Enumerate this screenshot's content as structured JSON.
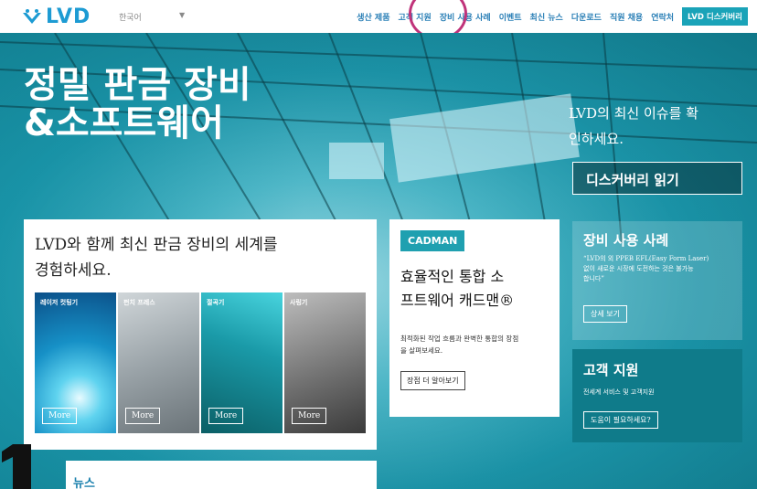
{
  "brand": {
    "name": "LVD",
    "color": "#1d9bd3"
  },
  "header": {
    "language": "한국어",
    "nav": [
      "생산 제품",
      "고객 지원",
      "장비 사용 사례",
      "이벤트",
      "최신 뉴스",
      "다운로드",
      "직원 채용",
      "연락처"
    ],
    "cta": "LVD 디스커버리",
    "accent": "#1aa3b8"
  },
  "hero": {
    "title_line1": "정밀 판금 장비",
    "title_line2": "&소프트웨어",
    "sub_line1": "LVD의 최신 이슈를 확",
    "sub_line2": "인하세요.",
    "discover_label": "디스커버리 읽기"
  },
  "main": {
    "heading_line1": "LVD와 함께 최신 판금 장비의 세계를",
    "heading_line2": "경험하세요.",
    "tiles": [
      {
        "label": "레이저 컷팅기",
        "button": "More"
      },
      {
        "label": "펀치 프레스",
        "button": "More"
      },
      {
        "label": "절곡기",
        "button": "More"
      },
      {
        "label": "사링기",
        "button": "More"
      }
    ]
  },
  "cadman": {
    "logo": "CADMAN",
    "heading_line1": "효율적인 통합 소",
    "heading_line2": "프트웨어 캐드맨®",
    "body_line1": "최적화된 작업 흐름과 완벽한 통합의 장점",
    "body_line2": "을 살펴보세요.",
    "button": "장점 더 알아보기"
  },
  "case": {
    "title": "장비 사용 사례",
    "body_line1": "“LVD의 외 PPEB EFL(Easy Form Laser)",
    "body_line2": "없이 새로운 시장에 도전하는 것은 불가능",
    "body_line3": "합니다”",
    "button": "상세 보기"
  },
  "support": {
    "title": "고객 지원",
    "body": "전세계 서비스 및 고객지원",
    "button": "도움이 필요하세요?"
  },
  "news": {
    "label": "뉴스"
  }
}
